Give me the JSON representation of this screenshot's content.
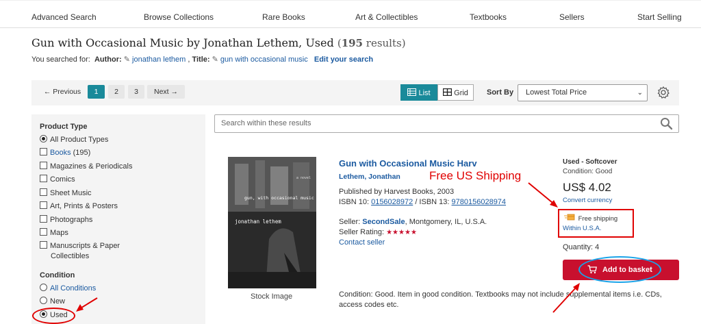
{
  "topnav": [
    "Advanced Search",
    "Browse Collections",
    "Rare Books",
    "Art & Collectibles",
    "Textbooks",
    "Sellers",
    "Start Selling"
  ],
  "heading": {
    "title": "Gun with Occasional Music by Jonathan Lethem, Used",
    "count_open": "(",
    "count": "195",
    "count_close": " results)"
  },
  "searched": {
    "prefix": "You searched for:",
    "author_label": "Author:",
    "author_value": "jonathan lethem",
    "sep": ",",
    "title_label": "Title:",
    "title_value": "gun with occasional music",
    "edit": "Edit your search"
  },
  "toolbar": {
    "previous": "← Previous",
    "pages": [
      "1",
      "2",
      "3"
    ],
    "next": "Next →",
    "list": "List",
    "grid": "Grid",
    "sort_label": "Sort By",
    "sort_value": "Lowest Total Price"
  },
  "sidebar": {
    "product_type_heading": "Product Type",
    "all_types": "All Product Types",
    "books": "Books",
    "books_count": "(195)",
    "types": [
      "Magazines & Periodicals",
      "Comics",
      "Sheet Music",
      "Art, Prints & Posters",
      "Photographs",
      "Maps"
    ],
    "manuscripts_1": "Manuscripts & Paper",
    "manuscripts_2": "Collectibles",
    "condition_heading": "Condition",
    "all_conditions": "All Conditions",
    "new": "New",
    "used": "Used"
  },
  "search_within": {
    "placeholder": "Search within these results"
  },
  "listing": {
    "title": "Gun with Occasional Music Harv",
    "author": "Lethem, Jonathan",
    "publisher": "Published by Harvest Books, 2003",
    "isbn10_label": "ISBN 10: ",
    "isbn10": "0156028972",
    "isbn13_label": " / ISBN 13: ",
    "isbn13": "9780156028974",
    "seller_label": "Seller: ",
    "seller": "SecondSale",
    "seller_loc": ", Montgomery, IL, U.S.A.",
    "rating_label": "Seller Rating: ",
    "rating_stars": 5,
    "contact": "Contact seller",
    "stock_image": "Stock Image",
    "condition_text": "Condition: Good. Item in good condition. Textbooks may not include supplemental items i.e. CDs, access codes etc.",
    "cover": {
      "author": "jonathan lethem",
      "title": "gun, with occasional music",
      "tag": "a novel"
    }
  },
  "pricebox": {
    "binding": "Used - Softcover",
    "condition": "Condition: Good",
    "price": "US$ 4.02",
    "convert": "Convert currency",
    "free_shipping": "Free shipping",
    "within": "Within U.S.A.",
    "quantity": "Quantity: 4",
    "add_to_basket": "Add to basket"
  },
  "annotation": {
    "text": "Free US Shipping"
  },
  "colors": {
    "accent": "#1a8a9a",
    "link": "#1b5aa0",
    "basket": "#c8102e",
    "annotation_red": "#e00000",
    "annotation_blue": "#1aa3e8"
  }
}
